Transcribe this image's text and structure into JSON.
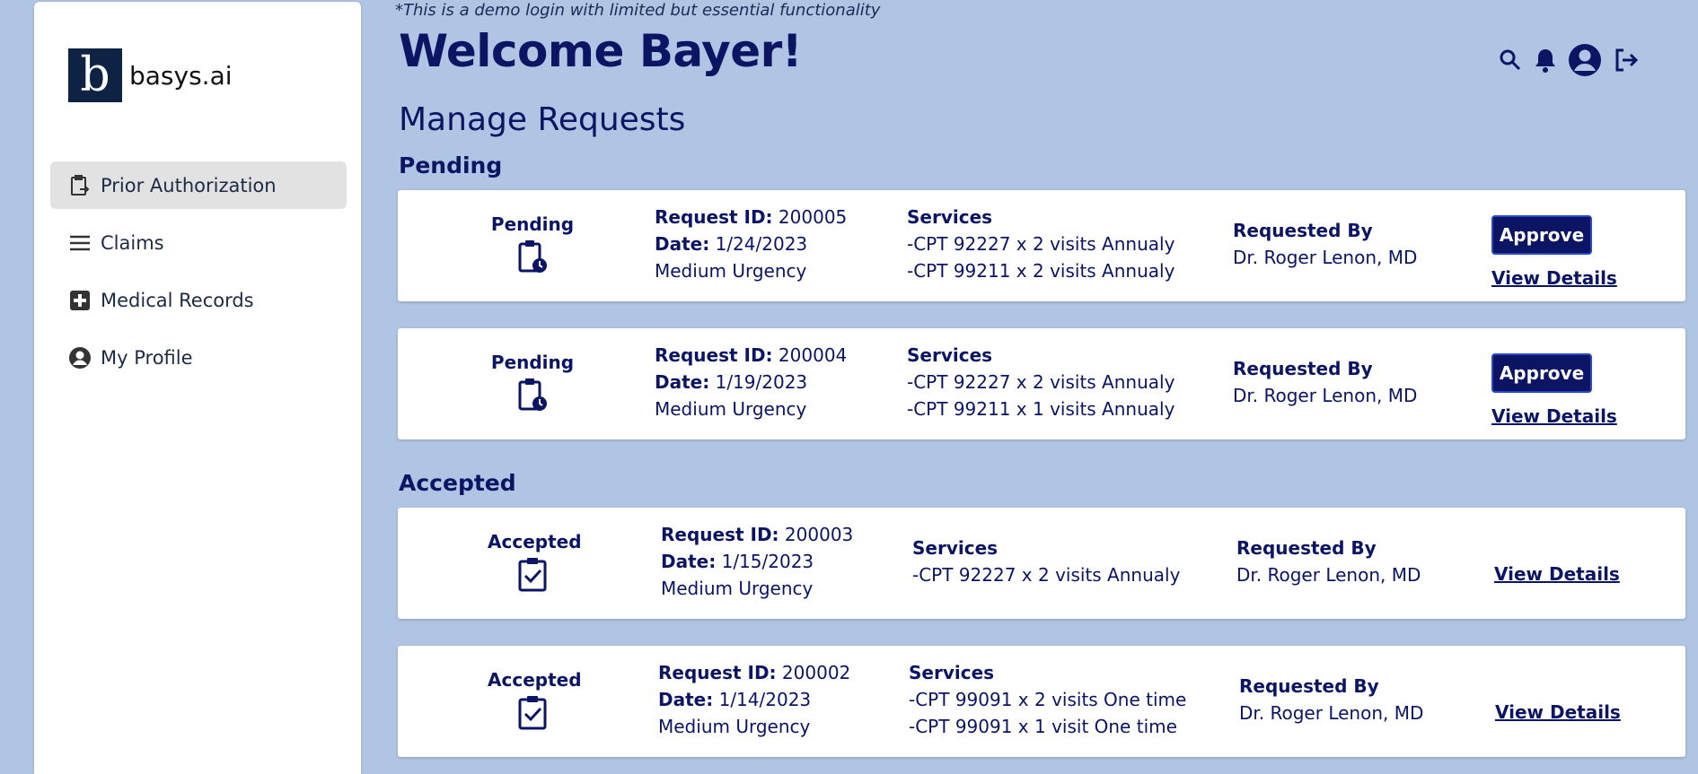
{
  "brand": {
    "logo_letter": "b",
    "name": "basys.ai"
  },
  "sidebar": {
    "items": [
      {
        "label": "Prior Authorization",
        "icon": "clipboard-transfer-icon",
        "active": true
      },
      {
        "label": "Claims",
        "icon": "menu-lines-icon",
        "active": false
      },
      {
        "label": "Medical Records",
        "icon": "medical-plus-icon",
        "active": false
      },
      {
        "label": "My Profile",
        "icon": "account-circle-icon",
        "active": false
      }
    ]
  },
  "header": {
    "demo_note": "*This is a demo login with limited but essential functionality",
    "welcome": "Welcome Bayer!",
    "icons": [
      "search-icon",
      "bell-icon",
      "account-circle-icon",
      "logout-icon"
    ]
  },
  "main": {
    "title": "Manage Requests",
    "pending": {
      "title": "Pending",
      "cards": [
        {
          "status": "Pending",
          "request_id_label": "Request ID:",
          "request_id": "200005",
          "date_label": "Date:",
          "date": "1/24/2023",
          "urgency": "Medium Urgency",
          "services_label": "Services",
          "services": [
            "-CPT 92227 x 2 visits Annualy",
            "-CPT 99211 x 2 visits Annualy"
          ],
          "requested_by_label": "Requested By",
          "requested_by": "Dr. Roger Lenon, MD",
          "approve": "Approve",
          "view": "View Details"
        },
        {
          "status": "Pending",
          "request_id_label": "Request ID:",
          "request_id": "200004",
          "date_label": "Date:",
          "date": "1/19/2023",
          "urgency": "Medium Urgency",
          "services_label": "Services",
          "services": [
            "-CPT 92227 x 2 visits Annualy",
            "-CPT 99211 x 1 visits Annualy"
          ],
          "requested_by_label": "Requested By",
          "requested_by": "Dr. Roger Lenon, MD",
          "approve": "Approve",
          "view": "View Details"
        }
      ]
    },
    "accepted": {
      "title": "Accepted",
      "cards": [
        {
          "status": "Accepted",
          "request_id_label": "Request ID:",
          "request_id": "200003",
          "date_label": "Date:",
          "date": "1/15/2023",
          "urgency": "Medium Urgency",
          "services_label": "Services",
          "services": [
            "-CPT 92227 x 2 visits Annualy"
          ],
          "requested_by_label": "Requested By",
          "requested_by": "Dr. Roger Lenon, MD",
          "view": "View Details"
        },
        {
          "status": "Accepted",
          "request_id_label": "Request ID:",
          "request_id": "200002",
          "date_label": "Date:",
          "date": "1/14/2023",
          "urgency": "Medium Urgency",
          "services_label": "Services",
          "services": [
            "-CPT 99091 x 2 visits One time",
            "-CPT 99091 x 1 visit One time"
          ],
          "requested_by_label": "Requested By",
          "requested_by": "Dr. Roger Lenon, MD",
          "view": "View Details"
        }
      ]
    }
  },
  "colors": {
    "background": "#b0c4e3",
    "primary": "#0b1563",
    "sidebar_active": "#e2e2e2",
    "logo_bg": "#0e2344"
  }
}
